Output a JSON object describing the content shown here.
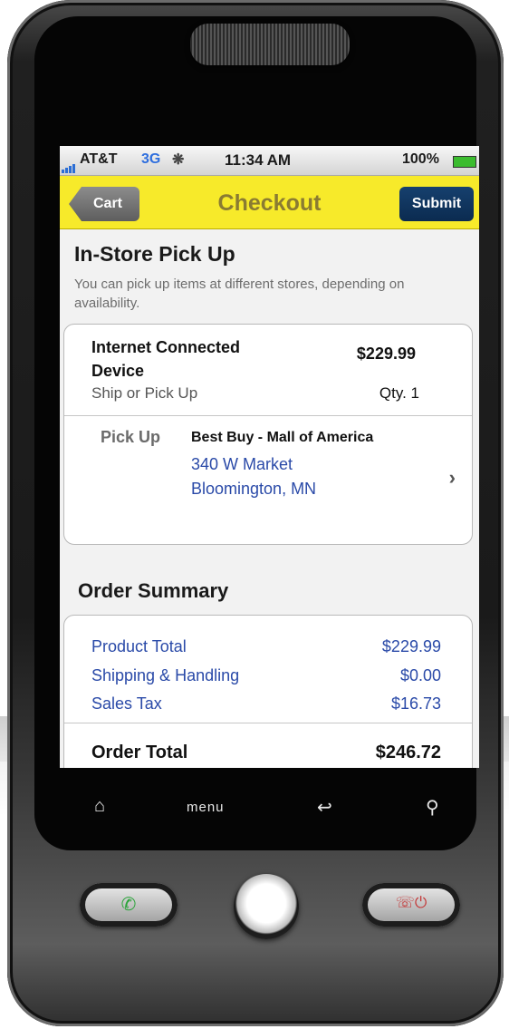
{
  "status_bar": {
    "carrier": "AT&T",
    "network": "3G",
    "time": "11:34 AM",
    "battery": "100%"
  },
  "nav": {
    "back_label": "Cart",
    "title": "Checkout",
    "submit_label": "Submit"
  },
  "pickup": {
    "title": "In-Store Pick Up",
    "subtitle": "You can pick up items at different stores, depending on availability.",
    "item": {
      "name": "Internet Connected Device",
      "price": "$229.99",
      "shipping_note": "Ship or Pick Up",
      "quantity": "Qty. 1"
    },
    "pickup_label": "Pick Up",
    "store_name": "Best Buy - Mall of America",
    "address_line1": "340 W Market",
    "address_line2": "Bloomington, MN"
  },
  "summary": {
    "title": "Order Summary",
    "rows": [
      {
        "label": "Product Total",
        "value": "$229.99"
      },
      {
        "label": "Shipping & Handling",
        "value": "$0.00"
      },
      {
        "label": "Sales Tax",
        "value": "$16.73"
      }
    ],
    "total_label": "Order Total",
    "total_value": "$246.72"
  },
  "hardware_keys": {
    "menu_label": "menu"
  },
  "colors": {
    "nav_background": "#f7ea2a",
    "submit_button": "#0b2b50",
    "link_blue": "#2a4aa8"
  }
}
